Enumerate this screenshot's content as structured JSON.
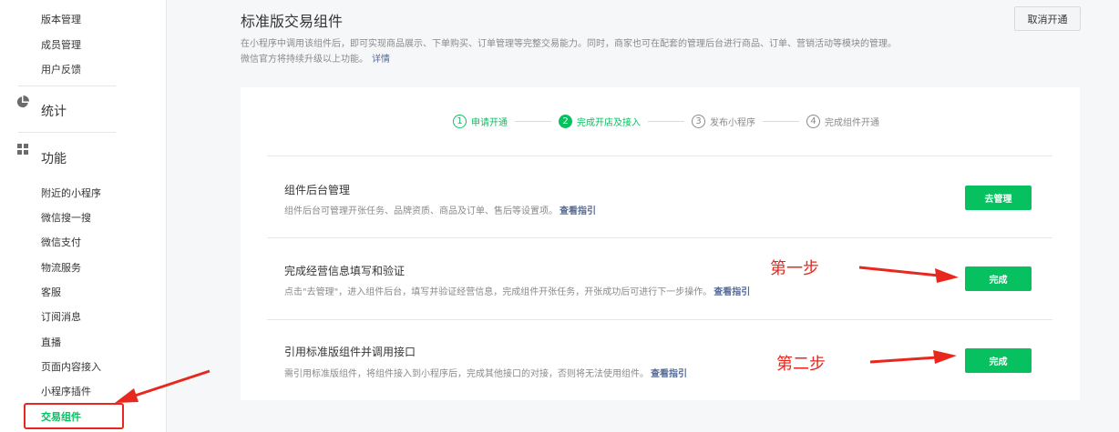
{
  "sidebar": {
    "top_items": [
      "版本管理",
      "成员管理",
      "用户反馈"
    ],
    "stats_label": "统计",
    "func_label": "功能",
    "func_items": [
      "附近的小程序",
      "微信搜一搜",
      "微信支付",
      "物流服务",
      "客服",
      "订阅消息",
      "直播",
      "页面内容接入",
      "小程序插件"
    ],
    "active_item": "交易组件"
  },
  "header": {
    "title": "标准版交易组件",
    "desc_line1": "在小程序中调用该组件后，即可实现商品展示、下单购买、订单管理等完整交易能力。同时，商家也可在配套的管理后台进行商品、订单、营销活动等模块的管理。",
    "desc_line2": "微信官方将持续升级以上功能。",
    "detail_link": "详情",
    "cancel_button": "取消开通"
  },
  "steps": [
    {
      "num": "1",
      "label": "申请开通",
      "state": "done"
    },
    {
      "num": "2",
      "label": "完成开店及接入",
      "state": "current"
    },
    {
      "num": "3",
      "label": "发布小程序",
      "state": "todo"
    },
    {
      "num": "4",
      "label": "完成组件开通",
      "state": "todo"
    }
  ],
  "rows": [
    {
      "title": "组件后台管理",
      "desc": "组件后台可管理开张任务、品牌资质、商品及订单、售后等设置项。",
      "link": "查看指引",
      "button": "去管理"
    },
    {
      "title": "完成经营信息填写和验证",
      "desc": "点击\"去管理\"，进入组件后台，填写并验证经营信息，完成组件开张任务，开张成功后可进行下一步操作。",
      "link": "查看指引",
      "button": "完成"
    },
    {
      "title": "引用标准版组件并调用接口",
      "desc": "需引用标准版组件，将组件接入到小程序后，完成其他接口的对接，否则将无法使用组件。",
      "link": "查看指引",
      "button": "完成"
    }
  ],
  "annotations": {
    "step1": "第一步",
    "step2": "第二步"
  },
  "colors": {
    "brand_green": "#07c160",
    "link_blue": "#576b95",
    "annotation_red": "#e8281e"
  }
}
